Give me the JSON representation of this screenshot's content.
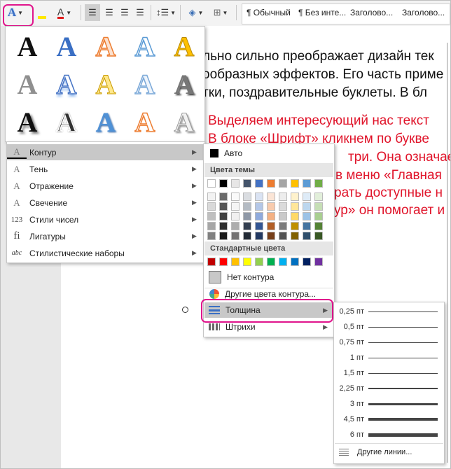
{
  "toolbar": {
    "text_effects_letter": "A",
    "font_color_letter": "A",
    "styles": [
      "¶ Обычный",
      "¶ Без инте...",
      "Заголово...",
      "Заголово..."
    ]
  },
  "document": {
    "lines": [
      "льно сильно преображает дизайн тек",
      "ообразных эффектов. Его часть приме",
      "тки, поздравительные буклеты. В бл"
    ],
    "red_lines": [
      "Выделяем интересующий нас текст",
      "В блоке «Шрифт» кликнем по букве",
      "три. Она означае",
      "в меню «Главная",
      "рать доступные н",
      "ур» он помогает и"
    ]
  },
  "menu": {
    "items": [
      {
        "label": "Контур",
        "icon": "A"
      },
      {
        "label": "Тень",
        "icon": "A"
      },
      {
        "label": "Отражение",
        "icon": "A"
      },
      {
        "label": "Свечение",
        "icon": "A"
      },
      {
        "label": "Стили чисел",
        "icon": "123"
      },
      {
        "label": "Лигатуры",
        "icon": "fi"
      },
      {
        "label": "Стилистические наборы",
        "icon": "abc"
      }
    ]
  },
  "outline": {
    "auto": "Авто",
    "theme_colors": "Цвета темы",
    "standard_colors": "Стандартные цвета",
    "no_outline": "Нет контура",
    "more_colors": "Другие цвета контура...",
    "weight": "Толщина",
    "dashes": "Штрихи",
    "theme_top": [
      "#ffffff",
      "#000000",
      "#e7e6e6",
      "#44546a",
      "#4472c4",
      "#ed7d31",
      "#a5a5a5",
      "#ffc000",
      "#5b9bd5",
      "#70ad47"
    ],
    "standard": [
      "#c00000",
      "#ff0000",
      "#ffc000",
      "#ffff00",
      "#92d050",
      "#00b050",
      "#00b0f0",
      "#0070c0",
      "#002060",
      "#7030a0"
    ]
  },
  "weights": {
    "items": [
      {
        "label": "0,25 пт",
        "pt": 0.25
      },
      {
        "label": "0,5 пт",
        "pt": 0.5
      },
      {
        "label": "0,75 пт",
        "pt": 0.75
      },
      {
        "label": "1 пт",
        "pt": 1
      },
      {
        "label": "1,5 пт",
        "pt": 1.5
      },
      {
        "label": "2,25 пт",
        "pt": 2.25
      },
      {
        "label": "3 пт",
        "pt": 3
      },
      {
        "label": "4,5 пт",
        "pt": 4.5
      },
      {
        "label": "6 пт",
        "pt": 6
      }
    ],
    "more": "Другие линии..."
  }
}
